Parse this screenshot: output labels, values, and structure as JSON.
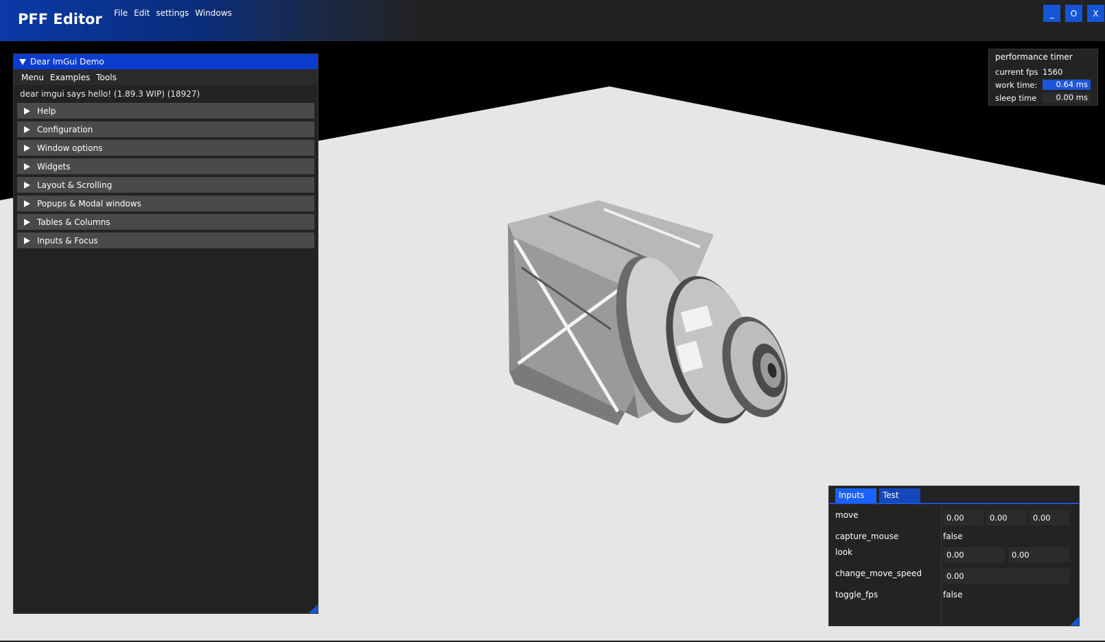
{
  "app": {
    "title": "PFF Editor",
    "menu": [
      "File",
      "Edit",
      "settings",
      "Windows"
    ],
    "window_controls": {
      "minimize": "_",
      "maximize": "O",
      "close": "X"
    }
  },
  "demo_window": {
    "title": "Dear ImGui Demo",
    "menu": [
      "Menu",
      "Examples",
      "Tools"
    ],
    "hello": "dear imgui says hello! (1.89.3 WIP) (18927)",
    "sections": [
      "Help",
      "Configuration",
      "Window options",
      "Widgets",
      "Layout & Scrolling",
      "Popups & Modal windows",
      "Tables & Columns",
      "Inputs & Focus"
    ]
  },
  "perf_window": {
    "title": "performance timer",
    "fps_label": "current fps",
    "fps_value": "1560",
    "work_label": "work time:",
    "work_value": "0.64 ms",
    "sleep_label": "sleep time",
    "sleep_value": "0.00 ms"
  },
  "inputs_window": {
    "tabs": [
      "Inputs",
      "Test"
    ],
    "move_label": "move",
    "move_values": [
      "0.00",
      "0.00",
      "0.00"
    ],
    "capture_mouse_label": "capture_mouse",
    "capture_mouse_value": "false",
    "look_label": "look",
    "look_values": [
      "0.00",
      "0.00"
    ],
    "change_move_speed_label": "change_move_speed",
    "change_move_speed_value": "0.00",
    "toggle_fps_label": "toggle_fps",
    "toggle_fps_value": "false"
  },
  "colors": {
    "accent": "#1b56d8",
    "title_active": "#0a3ccf",
    "panel": "#232323",
    "floor": "#e6e6e6"
  }
}
